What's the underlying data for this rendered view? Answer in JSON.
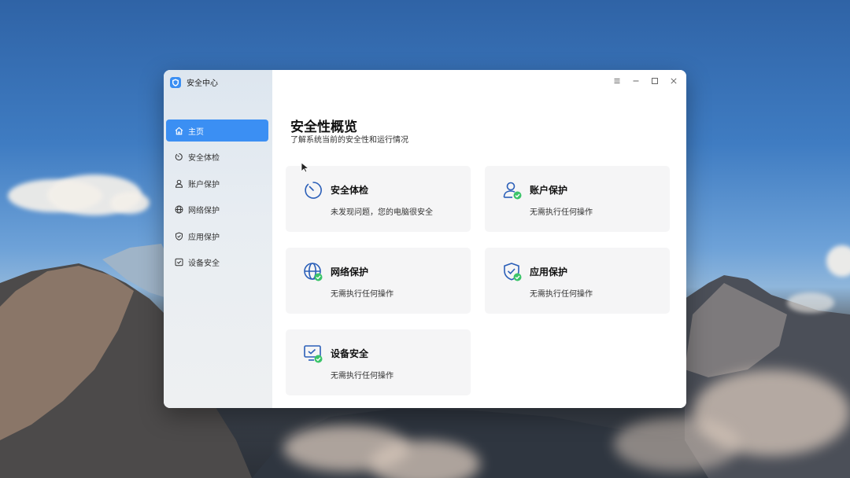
{
  "app": {
    "title": "安全中心"
  },
  "nav": {
    "items": [
      {
        "label": "主页",
        "icon": "home-icon",
        "active": true
      },
      {
        "label": "安全体检",
        "icon": "checkup-icon"
      },
      {
        "label": "账户保护",
        "icon": "user-icon"
      },
      {
        "label": "网络保护",
        "icon": "globe-icon"
      },
      {
        "label": "应用保护",
        "icon": "shield-icon"
      },
      {
        "label": "设备安全",
        "icon": "device-check-icon"
      }
    ]
  },
  "window_controls": [
    "menu-icon",
    "minimize-icon",
    "maximize-icon",
    "close-icon"
  ],
  "main": {
    "title": "安全性概览",
    "subtitle": "了解系统当前的安全性和运行情况",
    "cards": [
      {
        "title": "安全体检",
        "desc": "未发现问题，您的电脑很安全",
        "icon": "checkup-icon"
      },
      {
        "title": "账户保护",
        "desc": "无需执行任何操作",
        "icon": "user-check-icon"
      },
      {
        "title": "网络保护",
        "desc": "无需执行任何操作",
        "icon": "globe-check-icon"
      },
      {
        "title": "应用保护",
        "desc": "无需执行任何操作",
        "icon": "shield-check-icon"
      },
      {
        "title": "设备安全",
        "desc": "无需执行任何操作",
        "icon": "monitor-check-icon"
      }
    ]
  },
  "colors": {
    "accent": "#3b8ff3",
    "ok": "#3cc46a",
    "icon": "#2b5fb8"
  }
}
